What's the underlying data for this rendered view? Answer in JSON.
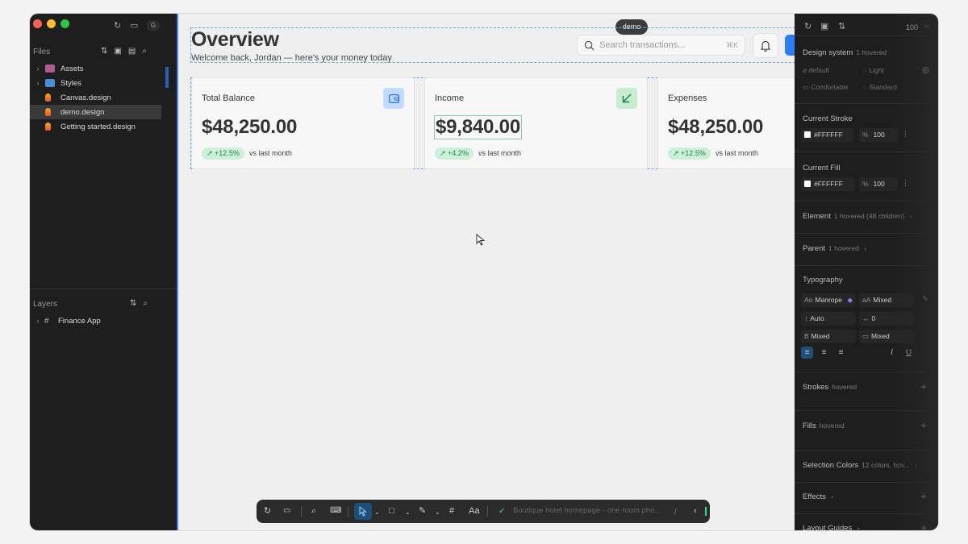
{
  "sidebar": {
    "files_title": "Files",
    "files": [
      {
        "label": "Assets",
        "icon": "assets-folder-icon",
        "expandable": true
      },
      {
        "label": "Styles",
        "icon": "styles-folder-icon",
        "expandable": true
      },
      {
        "label": "Canvas.design",
        "icon": "design-file-icon",
        "expandable": false
      },
      {
        "label": "demo.design",
        "icon": "design-file-icon",
        "expandable": false,
        "selected": true
      },
      {
        "label": "Getting started.design",
        "icon": "design-file-icon",
        "expandable": false
      }
    ],
    "layers_title": "Layers",
    "layers": [
      {
        "label": "Finance App",
        "icon": "frame-icon"
      }
    ],
    "avatar_letter": "G"
  },
  "canvas": {
    "tab_label": "demo",
    "page_title": "Overview",
    "subtitle": "Welcome back, Jordan — here's your money today",
    "search_placeholder": "Search transactions...",
    "search_shortcut": "⌘K",
    "cards": [
      {
        "title": "Total Balance",
        "value": "$48,250.00",
        "change": "+12.5%",
        "compare": "vs last month",
        "icon": "wallet-icon",
        "icon_bg": "#bfdbfe",
        "icon_color": "#2563eb"
      },
      {
        "title": "Income",
        "value": "$9,840.00",
        "change": "+4.2%",
        "compare": "vs last month",
        "icon": "arrow-down-left-icon",
        "icon_bg": "#c8ecd2",
        "icon_color": "#15803d"
      },
      {
        "title": "Expenses",
        "value": "$48,250.00",
        "change": "+12.5%",
        "compare": "vs last month",
        "icon": "",
        "icon_bg": "",
        "icon_color": ""
      }
    ]
  },
  "toolbar": {
    "status_text": "Boutique hotel homepage - one room pho...",
    "status_shortcut": "/",
    "text_tool": "Aa"
  },
  "inspector": {
    "zoom": "100",
    "zoom_unit": "%",
    "design_system": {
      "label": "Design system",
      "state": "1 hovered",
      "options": [
        "default",
        "Light",
        "Comfortable",
        "Standard"
      ]
    },
    "current_stroke": {
      "label": "Current Stroke",
      "hex": "#FFFFFF",
      "pct_symbol": "%",
      "opacity": "100"
    },
    "current_fill": {
      "label": "Current Fill",
      "hex": "#FFFFFF",
      "pct_symbol": "%",
      "opacity": "100"
    },
    "element": {
      "label": "Element",
      "state": "1 hovered (48 children)"
    },
    "parent": {
      "label": "Parent",
      "state": "1 hovered"
    },
    "typography": {
      "label": "Typography",
      "font": "Manrope",
      "font_prefix": "Ao",
      "size": "Mixed",
      "size_prefix": "aA",
      "line_height": "Auto",
      "letter_spacing": "0",
      "weight": "Mixed",
      "weight_prefix": "B",
      "case": "Mixed"
    },
    "strokes": {
      "label": "Strokes",
      "state": "hovered"
    },
    "fills": {
      "label": "Fills",
      "state": "hovered"
    },
    "selection_colors": {
      "label": "Selection Colors",
      "state": "12 colors, hov..."
    },
    "effects": {
      "label": "Effects"
    },
    "layout_guides": {
      "label": "Layout Guides"
    }
  },
  "colors": {
    "accent": "#3b82f6",
    "success": "#1f8a4c"
  }
}
